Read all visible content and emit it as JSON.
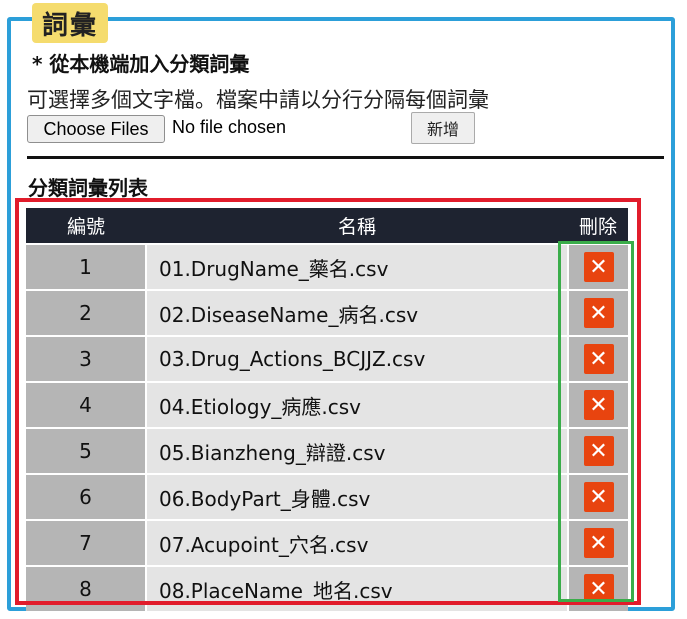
{
  "section": {
    "title": "詞彙"
  },
  "upload": {
    "heading": "* 從本機端加入分類詞彙",
    "hint": "可選擇多個文字檔。檔案中請以分行分隔每個詞彙",
    "choose_files_label": "Choose Files",
    "file_status": "No file chosen",
    "add_label": "新增"
  },
  "list": {
    "heading": "分類詞彙列表",
    "columns": {
      "number": "編號",
      "name": "名稱",
      "delete": "刪除"
    },
    "rows": [
      {
        "number": "1",
        "name": "01.DrugName_藥名.csv"
      },
      {
        "number": "2",
        "name": "02.DiseaseName_病名.csv"
      },
      {
        "number": "3",
        "name": "03.Drug_Actions_BCJJZ.csv"
      },
      {
        "number": "4",
        "name": "04.Etiology_病應.csv"
      },
      {
        "number": "5",
        "name": "05.Bianzheng_辯證.csv"
      },
      {
        "number": "6",
        "name": "06.BodyPart_身體.csv"
      },
      {
        "number": "7",
        "name": "07.Acupoint_穴名.csv"
      },
      {
        "number": "8",
        "name": "08.PlaceName_地名.csv"
      }
    ],
    "delete_icon": "✕"
  },
  "colors": {
    "frame": "#2c9fd9",
    "tab": "#f5dc6e",
    "header": "#1e2330",
    "delete": "#e8440f",
    "highlight_red": "#e11c2b",
    "highlight_green": "#3aad4a"
  }
}
